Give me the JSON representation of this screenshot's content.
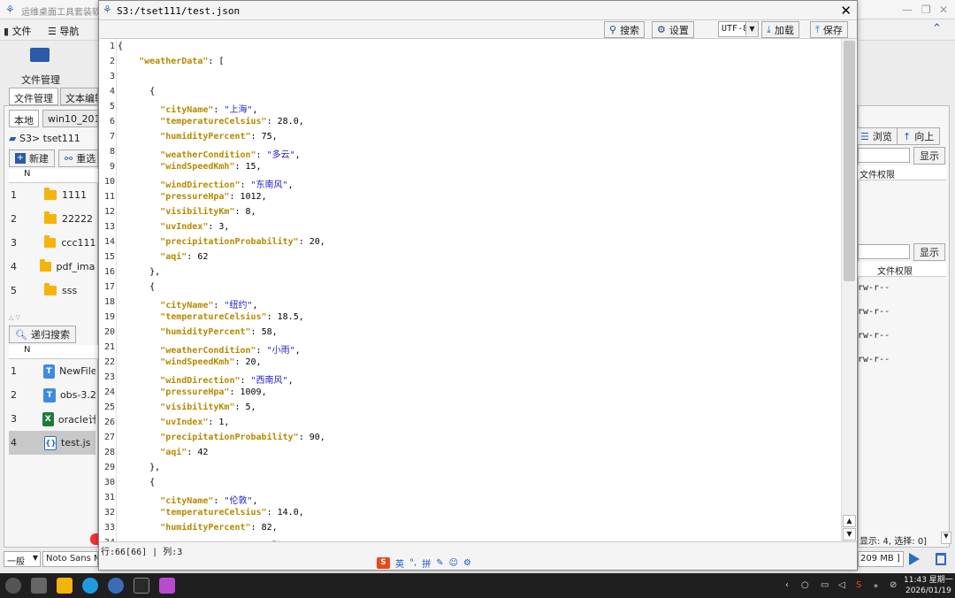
{
  "background_app": {
    "title": "运维桌面工具套装软件",
    "menu": {
      "file": "文件",
      "nav": "导航"
    },
    "toolbar_label": "文件管理",
    "tabs": [
      "文件管理",
      "文本编辑"
    ],
    "conn_tabs": [
      "本地",
      "win10_201"
    ],
    "path": "S3> tset111",
    "buttons": {
      "new": "新建",
      "refresh": "重选",
      "recursive_search": "递归搜索",
      "browse": "浏览",
      "up": "向上",
      "show": "显示"
    },
    "col_n": "N",
    "folders": [
      {
        "n": "1",
        "name": "1111"
      },
      {
        "n": "2",
        "name": "22222"
      },
      {
        "n": "3",
        "name": "ccc111"
      },
      {
        "n": "4",
        "name": "pdf_imag"
      },
      {
        "n": "5",
        "name": "sss"
      }
    ],
    "files": [
      {
        "n": "1",
        "name": "NewFile",
        "icon": "text-file-icon"
      },
      {
        "n": "2",
        "name": "obs-3.2",
        "icon": "text-file-icon"
      },
      {
        "n": "3",
        "name": "oracle计",
        "icon": "excel-file-icon"
      },
      {
        "n": "4",
        "name": "test.js",
        "icon": "json-file-icon"
      }
    ],
    "right_header": "文件权限",
    "permissions": [
      "rw-r--",
      "rw-r--",
      "rw-r--",
      "rw-r--"
    ],
    "status_right": "显示: 4, 选择: 0]",
    "size_label": "209 MB ]",
    "font_select": {
      "category": "一般",
      "font": "Noto Sans M"
    }
  },
  "editor": {
    "title": "S3:/tset111/test.json",
    "buttons": {
      "search": "搜索",
      "settings": "设置",
      "load": "加载",
      "save": "保存"
    },
    "encoding": "UTF-8",
    "status": "行:66[66]  |  列:3",
    "ime": [
      "英",
      "°,",
      "拼"
    ]
  },
  "code_lines": [
    {
      "n": 1,
      "t": "{"
    },
    {
      "n": 2,
      "t": "    \"weatherData\": ["
    },
    {
      "n": 3,
      "t": ""
    },
    {
      "n": 4,
      "t": "      {"
    },
    {
      "n": 5,
      "t": "        \"cityName\": \"上海\","
    },
    {
      "n": 6,
      "t": "        \"temperatureCelsius\": 28.0,"
    },
    {
      "n": 7,
      "t": "        \"humidityPercent\": 75,"
    },
    {
      "n": 8,
      "t": "        \"weatherCondition\": \"多云\","
    },
    {
      "n": 9,
      "t": "        \"windSpeedKmh\": 15,"
    },
    {
      "n": 10,
      "t": "        \"windDirection\": \"东南风\","
    },
    {
      "n": 11,
      "t": "        \"pressureHpa\": 1012,"
    },
    {
      "n": 12,
      "t": "        \"visibilityKm\": 8,"
    },
    {
      "n": 13,
      "t": "        \"uvIndex\": 3,"
    },
    {
      "n": 14,
      "t": "        \"precipitationProbability\": 20,"
    },
    {
      "n": 15,
      "t": "        \"aqi\": 62"
    },
    {
      "n": 16,
      "t": "      },"
    },
    {
      "n": 17,
      "t": "      {"
    },
    {
      "n": 18,
      "t": "        \"cityName\": \"纽约\","
    },
    {
      "n": 19,
      "t": "        \"temperatureCelsius\": 18.5,"
    },
    {
      "n": 20,
      "t": "        \"humidityPercent\": 58,"
    },
    {
      "n": 21,
      "t": "        \"weatherCondition\": \"小雨\","
    },
    {
      "n": 22,
      "t": "        \"windSpeedKmh\": 20,"
    },
    {
      "n": 23,
      "t": "        \"windDirection\": \"西南风\","
    },
    {
      "n": 24,
      "t": "        \"pressureHpa\": 1009,"
    },
    {
      "n": 25,
      "t": "        \"visibilityKm\": 5,"
    },
    {
      "n": 26,
      "t": "        \"uvIndex\": 1,"
    },
    {
      "n": 27,
      "t": "        \"precipitationProbability\": 90,"
    },
    {
      "n": 28,
      "t": "        \"aqi\": 42"
    },
    {
      "n": 29,
      "t": "      },"
    },
    {
      "n": 30,
      "t": "      {"
    },
    {
      "n": 31,
      "t": "        \"cityName\": \"伦敦\","
    },
    {
      "n": 32,
      "t": "        \"temperatureCelsius\": 14.0,"
    },
    {
      "n": 33,
      "t": "        \"humidityPercent\": 82,"
    },
    {
      "n": 34,
      "t": "        \"weatherCondition\": \"阴\","
    }
  ],
  "taskbar": {
    "time": "11:43 星期一",
    "date": "2026/01/19"
  }
}
